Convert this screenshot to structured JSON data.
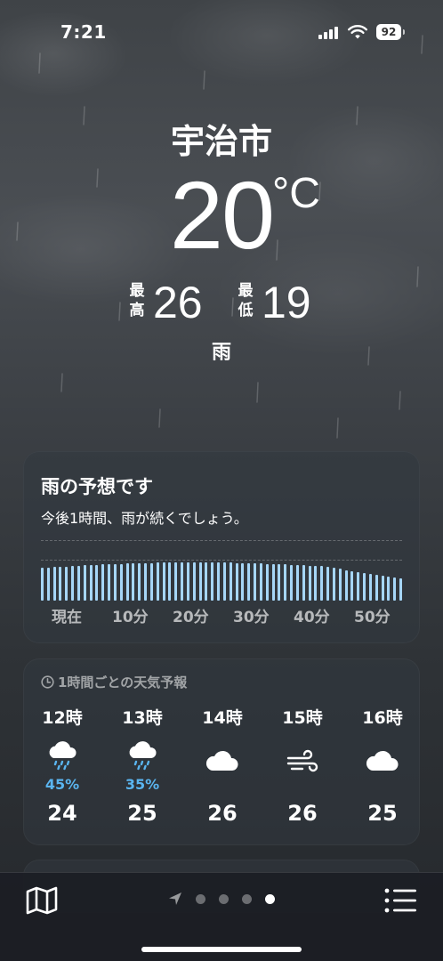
{
  "status_bar": {
    "time": "7:21",
    "battery": "92"
  },
  "header": {
    "city": "宇治市",
    "temperature": "20",
    "unit": "°C",
    "high_label": "最高",
    "high": "26",
    "low_label": "最低",
    "low": "19",
    "condition": "雨"
  },
  "rain_card": {
    "title": "雨の予想です",
    "description": "今後1時間、雨が続くでしょう。",
    "minute_labels": [
      "現在",
      "10分",
      "20分",
      "30分",
      "40分",
      "50分"
    ]
  },
  "hourly_card": {
    "header": "1時間ごとの天気予報",
    "hours": [
      {
        "time": "12時",
        "icon": "cloud-rain-icon",
        "pop": "45%",
        "temp": "24"
      },
      {
        "time": "13時",
        "icon": "cloud-rain-icon",
        "pop": "35%",
        "temp": "25"
      },
      {
        "time": "14時",
        "icon": "cloud-icon",
        "pop": "",
        "temp": "26"
      },
      {
        "time": "15時",
        "icon": "wind-icon",
        "pop": "",
        "temp": "26"
      },
      {
        "time": "16時",
        "icon": "cloud-icon",
        "pop": "",
        "temp": "25"
      }
    ]
  },
  "toolbar": {
    "map_icon": "map-icon",
    "location_icon": "location-arrow-icon",
    "list_icon": "list-icon",
    "page_count": 4,
    "active_page": 4
  },
  "colors": {
    "precip_bar": "#a6d6f7",
    "precip_text": "#5ab5f0"
  }
}
